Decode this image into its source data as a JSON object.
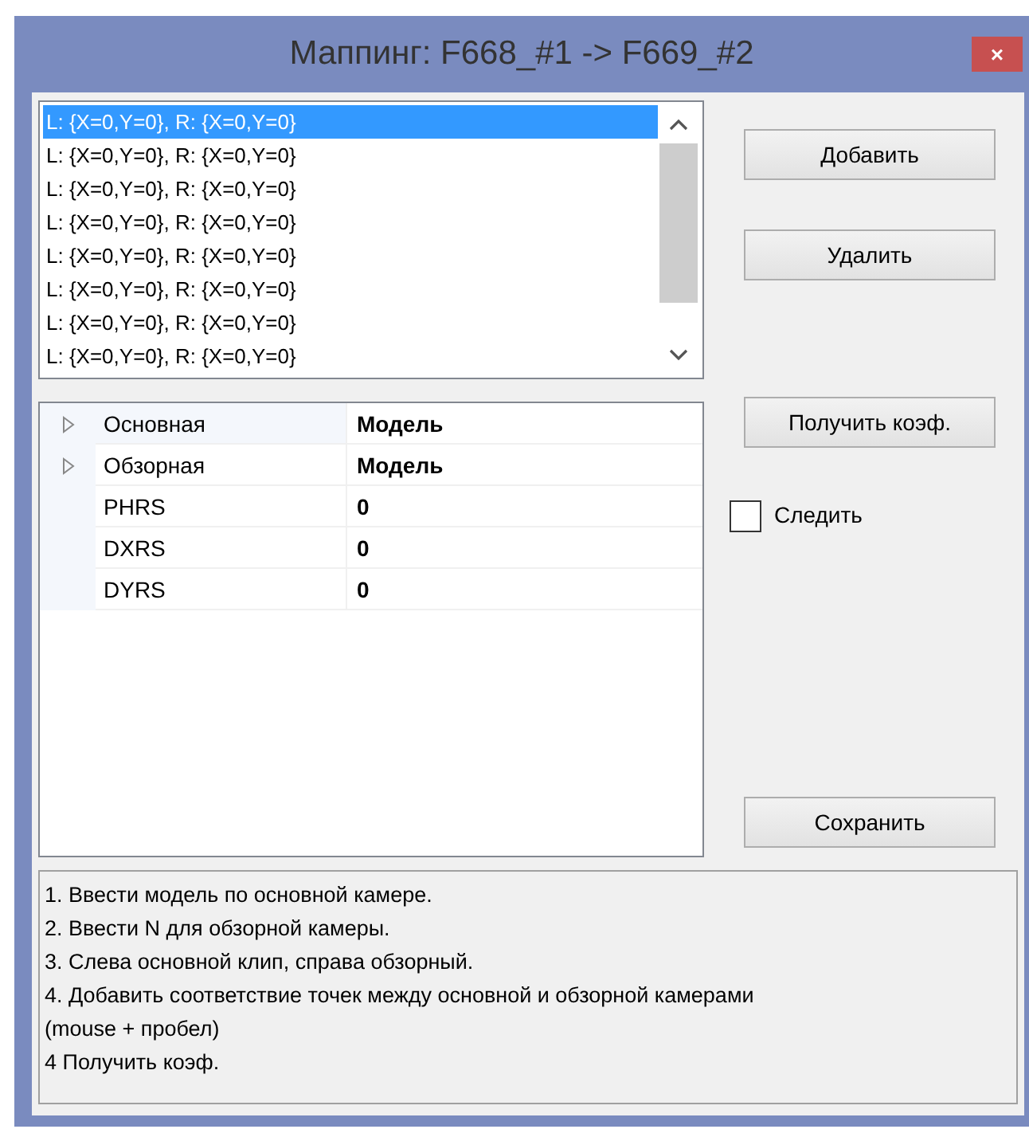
{
  "window": {
    "title": "Маппинг: F668_#1 -> F669_#2",
    "close": "×"
  },
  "points": [
    {
      "text": "L: {X=0,Y=0}, R: {X=0,Y=0}",
      "selected": true
    },
    {
      "text": "L: {X=0,Y=0}, R: {X=0,Y=0}",
      "selected": false
    },
    {
      "text": "L: {X=0,Y=0}, R: {X=0,Y=0}",
      "selected": false
    },
    {
      "text": "L: {X=0,Y=0}, R: {X=0,Y=0}",
      "selected": false
    },
    {
      "text": "L: {X=0,Y=0}, R: {X=0,Y=0}",
      "selected": false
    },
    {
      "text": "L: {X=0,Y=0}, R: {X=0,Y=0}",
      "selected": false
    },
    {
      "text": "L: {X=0,Y=0}, R: {X=0,Y=0}",
      "selected": false
    },
    {
      "text": "L: {X=0,Y=0}, R: {X=0,Y=0}",
      "selected": false
    }
  ],
  "buttons_top": [
    "Добавить",
    "Удалить"
  ],
  "properties": [
    {
      "name": "Основная",
      "value": "Модель",
      "expanded": false,
      "expandable": true
    },
    {
      "name": "Обзорная",
      "value": "Модель",
      "expanded": false,
      "expandable": true
    },
    {
      "name": "PHRS",
      "value": "0",
      "expandable": false
    },
    {
      "name": "DXRS",
      "value": "0",
      "expandable": false
    },
    {
      "name": "DYRS",
      "value": "0",
      "expandable": false
    }
  ],
  "get_coef_button": "Получить коэф.",
  "follow": {
    "label": "Следить",
    "checked": false
  },
  "save_button": "Сохранить",
  "instructions": [
    "1. Ввести модель по основной камере.",
    "2. Ввести N для обзорной камеры.",
    "3. Слева основной клип, справа обзорный.",
    "4. Добавить соответствие точек между основной и обзорной камерами",
    "(mouse + пробел)",
    "4 Получить коэф."
  ]
}
